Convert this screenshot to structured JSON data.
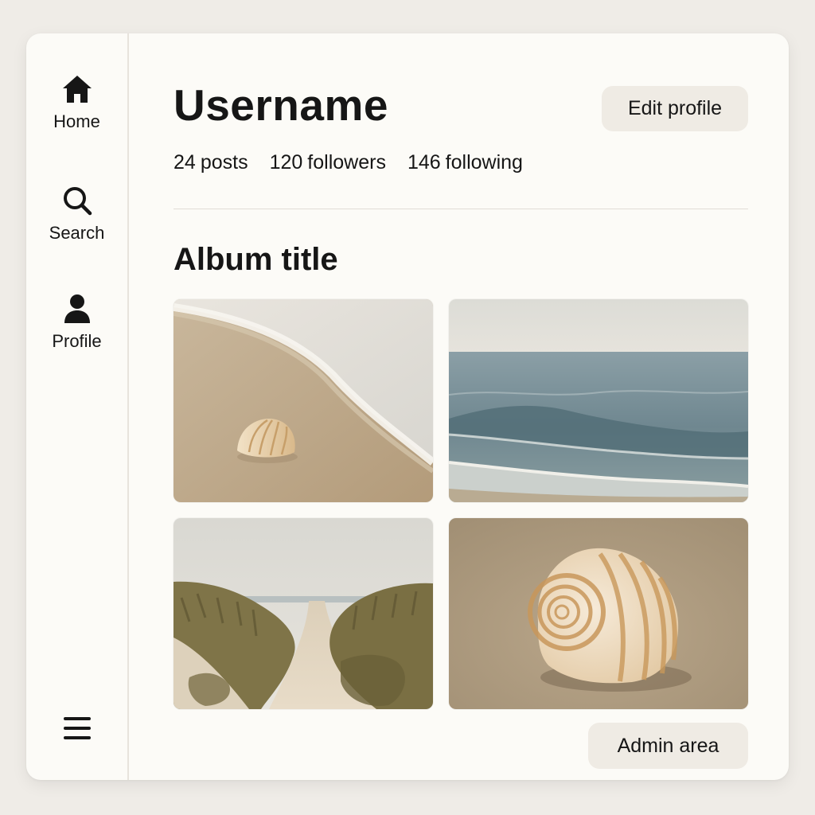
{
  "sidebar": {
    "items": [
      {
        "label": "Home",
        "icon": "home-icon"
      },
      {
        "label": "Search",
        "icon": "search-icon"
      },
      {
        "label": "Profile",
        "icon": "user-icon"
      }
    ],
    "menu_icon": "hamburger-menu-icon"
  },
  "profile": {
    "username": "Username",
    "edit_label": "Edit profile",
    "stats": [
      {
        "count": "24",
        "label": "posts"
      },
      {
        "count": "120",
        "label": "followers"
      },
      {
        "count": "146",
        "label": "following"
      }
    ]
  },
  "album": {
    "title": "Album title",
    "photos": [
      {
        "subject": "seashell on sandy beach at shoreline"
      },
      {
        "subject": "ocean waves rolling toward shore"
      },
      {
        "subject": "sand path through grassy dunes"
      },
      {
        "subject": "spiral shell on sand close-up"
      }
    ]
  },
  "admin_label": "Admin area",
  "colors": {
    "page_background": "#efece7",
    "card_background": "#fcfbf7",
    "button_background": "#efebe4",
    "text": "#161616",
    "divider": "#e1ddd6"
  }
}
